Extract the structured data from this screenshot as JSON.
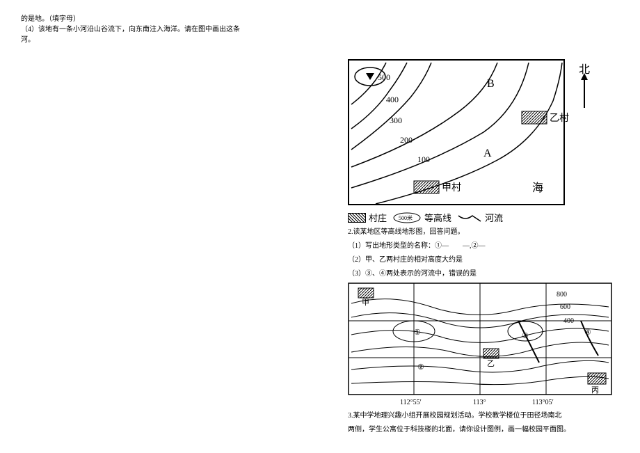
{
  "left": {
    "line1": "的是地。（填字母）",
    "line2": "（4）该地有一条小河沿山谷流下，向东南注入海洋。请在图中画出这条",
    "line3": "河。"
  },
  "map1": {
    "c500": "500",
    "c400": "400",
    "c300": "300",
    "c200": "200",
    "c100": "100",
    "labelA": "A",
    "labelB": "B",
    "villageJia": "甲村",
    "villageYi": "乙村",
    "sea": "海",
    "north": "北"
  },
  "legend1": {
    "village": "村庄",
    "contourVal": "500米",
    "contour": "等高线",
    "river": "河流"
  },
  "q2": {
    "title": "2.读某地区等高线地形图，回答问题。",
    "sub1": "（1）写出地形类型的名称：①—　　—,②—",
    "sub2": "（2）甲、乙两村庄的相对高度大约是",
    "sub3": "（3）③、④两处表示的河流中，错误的是"
  },
  "map2": {
    "c800": "800",
    "c600": "600",
    "c400": "400",
    "n1": "①",
    "n2": "②",
    "n3": "③",
    "n4": "④",
    "jia": "甲",
    "yi": "乙",
    "bing": "丙",
    "lon1": "112°55′",
    "lon2": "113°",
    "lon3": "113°05′"
  },
  "q3": {
    "line1": "3.某中学地理兴趣小组开展校园规划活动。学校教学楼位于田径场南北",
    "line2": "两侧，学生公寓位于科技楼的北面，请你设计图例，画一幅校园平面图。"
  }
}
